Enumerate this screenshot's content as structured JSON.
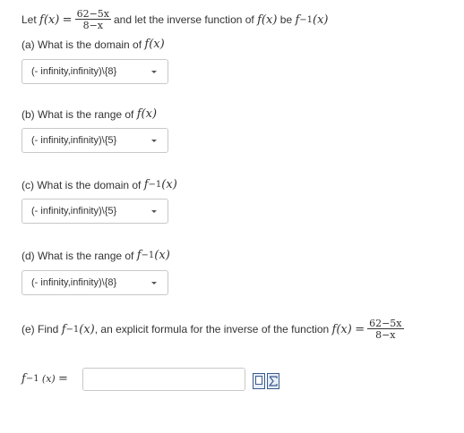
{
  "intro": {
    "let": "Let",
    "f_x": "f(x)",
    "eq": "=",
    "num": "62−5x",
    "den": "8−x",
    "text": "and let  the inverse function of",
    "f_x2": "f(x)",
    "be": "be",
    "finv": "f",
    "sup": "−1",
    "finv_arg": "(x)"
  },
  "questions": [
    {
      "label": "(a) What is the domain of",
      "math": "f(x)",
      "selected": "(- infinity,infinity)\\{8}"
    },
    {
      "label": "(b) What is the range of",
      "math": "f(x)",
      "selected": "(- infinity,infinity)\\{5}"
    },
    {
      "label": "(c) What is the domain of",
      "math": "f",
      "sup": "−1",
      "arg": "(x)",
      "selected": "(- infinity,infinity)\\{5}"
    },
    {
      "label": "(d) What is the range of",
      "math": "f",
      "sup": "−1",
      "arg": "(x)",
      "selected": "(- infinity,infinity)\\{8}"
    }
  ],
  "part_e": {
    "find": "(e) Find",
    "finv": "f",
    "sup": "−1",
    "arg": "(x)",
    "text": ", an explicit formula for the inverse of the function",
    "f_x": "f(x)",
    "eq": "=",
    "num": "62−5x",
    "den": "8−x",
    "answer_label_f": "f",
    "answer_label_sup": "−1",
    "answer_label_arg": "(x)",
    "answer_eq": "=",
    "answer_value": ""
  },
  "icons": [
    "formula-editor-icon",
    "sigma-preview-icon"
  ]
}
